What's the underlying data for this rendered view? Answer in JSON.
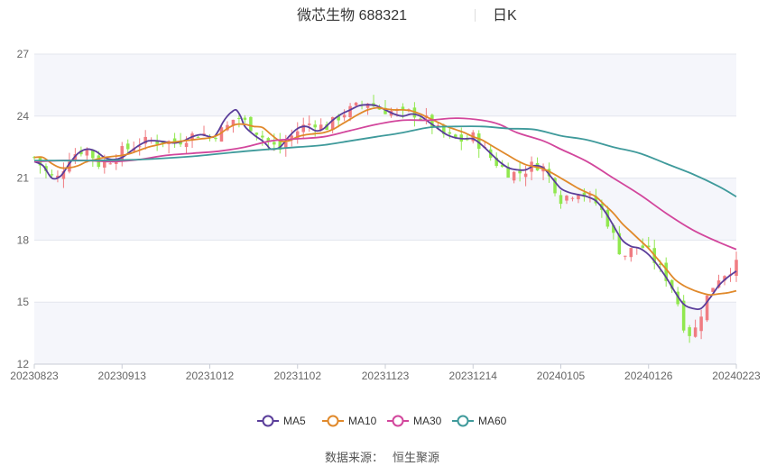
{
  "title": {
    "stock": "微芯生物 688321",
    "period": "日K"
  },
  "source": {
    "label": "数据来源：",
    "name": "恒生聚源"
  },
  "chart_data": {
    "type": "candlestick",
    "ylim": [
      12,
      27
    ],
    "yticks": [
      12,
      15,
      18,
      21,
      24,
      27
    ],
    "x_tick_labels": [
      "20230823",
      "20230913",
      "20231012",
      "20231102",
      "20231123",
      "20231214",
      "20240105",
      "20240126",
      "20240223"
    ],
    "band_fills": [
      "#f5f6fb",
      "#ffffff"
    ],
    "up_color": "#f07c82",
    "down_color": "#91e84f",
    "bars_count": 121,
    "close_path": [
      [
        0,
        22.0
      ],
      [
        3,
        21.2
      ],
      [
        5,
        20.9
      ],
      [
        8,
        22.0
      ],
      [
        10,
        22.3
      ],
      [
        12,
        22.4
      ],
      [
        15,
        21.6
      ],
      [
        18,
        22.0
      ],
      [
        20,
        22.3
      ],
      [
        23,
        22.6
      ],
      [
        26,
        22.8
      ],
      [
        29,
        22.8
      ],
      [
        32,
        22.7
      ],
      [
        35,
        23.0
      ],
      [
        38,
        23.2
      ],
      [
        40,
        23.0
      ],
      [
        42,
        23.2
      ],
      [
        44,
        23.5
      ],
      [
        46,
        24.0
      ],
      [
        48,
        23.7
      ],
      [
        50,
        23.4
      ],
      [
        52,
        23.0
      ],
      [
        54,
        22.6
      ],
      [
        56,
        22.4
      ],
      [
        58,
        22.9
      ],
      [
        60,
        23.3
      ],
      [
        62,
        23.6
      ],
      [
        64,
        23.7
      ],
      [
        66,
        23.4
      ],
      [
        68,
        23.7
      ],
      [
        70,
        24.1
      ],
      [
        72,
        24.3
      ],
      [
        74,
        24.5
      ],
      [
        76,
        24.7
      ],
      [
        78,
        24.4
      ],
      [
        80,
        24.3
      ],
      [
        82,
        24.2
      ],
      [
        84,
        24.1
      ],
      [
        86,
        24.2
      ],
      [
        88,
        24.0
      ],
      [
        90,
        23.7
      ],
      [
        92,
        23.3
      ],
      [
        94,
        23.0
      ],
      [
        96,
        22.9
      ],
      [
        98,
        22.8
      ],
      [
        100,
        23.0
      ],
      [
        102,
        22.5
      ],
      [
        104,
        22.0
      ],
      [
        106,
        21.6
      ],
      [
        108,
        21.3
      ],
      [
        110,
        21.2
      ],
      [
        112,
        21.4
      ],
      [
        114,
        21.7
      ],
      [
        116,
        21.5
      ],
      [
        118,
        20.8
      ],
      [
        120,
        20.0
      ],
      [
        122,
        20.2
      ],
      [
        124,
        20.4
      ],
      [
        126,
        20.1
      ],
      [
        128,
        19.8
      ],
      [
        130,
        19.2
      ],
      [
        132,
        18.2
      ],
      [
        134,
        17.2
      ],
      [
        136,
        17.5
      ],
      [
        138,
        17.8
      ],
      [
        140,
        17.4
      ],
      [
        142,
        16.8
      ],
      [
        144,
        16.2
      ],
      [
        146,
        15.5
      ],
      [
        148,
        13.9
      ],
      [
        150,
        13.3
      ],
      [
        152,
        14.5
      ],
      [
        154,
        15.6
      ],
      [
        156,
        16.2
      ],
      [
        158,
        16.5
      ],
      [
        160,
        16.8
      ]
    ],
    "series": [
      {
        "name": "MA5",
        "color": "#5a3d9a",
        "values": [
          [
            0,
            21.8
          ],
          [
            2,
            21.6
          ],
          [
            4,
            21.0
          ],
          [
            6,
            21.1
          ],
          [
            8,
            21.7
          ],
          [
            10,
            22.2
          ],
          [
            12,
            22.4
          ],
          [
            14,
            22.3
          ],
          [
            16,
            22.0
          ],
          [
            18,
            21.9
          ],
          [
            20,
            22.0
          ],
          [
            22,
            22.3
          ],
          [
            24,
            22.6
          ],
          [
            26,
            22.8
          ],
          [
            28,
            22.8
          ],
          [
            30,
            22.75
          ],
          [
            32,
            22.7
          ],
          [
            34,
            22.8
          ],
          [
            36,
            23.0
          ],
          [
            38,
            23.1
          ],
          [
            40,
            23.0
          ],
          [
            41,
            23.0
          ],
          [
            42,
            23.3
          ],
          [
            43,
            23.7
          ],
          [
            44,
            24.0
          ],
          [
            45,
            24.2
          ],
          [
            46,
            24.3
          ],
          [
            47,
            24.0
          ],
          [
            48,
            23.5
          ],
          [
            50,
            23.1
          ],
          [
            52,
            22.8
          ],
          [
            53,
            22.6
          ],
          [
            54,
            22.4
          ],
          [
            56,
            22.5
          ],
          [
            58,
            23.0
          ],
          [
            60,
            23.4
          ],
          [
            62,
            23.5
          ],
          [
            64,
            23.3
          ],
          [
            65,
            23.3
          ],
          [
            66,
            23.4
          ],
          [
            68,
            23.8
          ],
          [
            70,
            24.1
          ],
          [
            72,
            24.3
          ],
          [
            74,
            24.5
          ],
          [
            76,
            24.55
          ],
          [
            78,
            24.5
          ],
          [
            80,
            24.3
          ],
          [
            82,
            24.1
          ],
          [
            84,
            24.0
          ],
          [
            86,
            24.1
          ],
          [
            88,
            24.0
          ],
          [
            90,
            23.7
          ],
          [
            92,
            23.4
          ],
          [
            94,
            23.1
          ],
          [
            96,
            22.95
          ],
          [
            98,
            22.9
          ],
          [
            100,
            22.9
          ],
          [
            102,
            22.6
          ],
          [
            104,
            22.2
          ],
          [
            106,
            21.8
          ],
          [
            108,
            21.5
          ],
          [
            110,
            21.4
          ],
          [
            112,
            21.4
          ],
          [
            114,
            21.6
          ],
          [
            116,
            21.5
          ],
          [
            118,
            21.0
          ],
          [
            120,
            20.5
          ],
          [
            122,
            20.3
          ],
          [
            124,
            20.2
          ],
          [
            126,
            20.1
          ],
          [
            128,
            19.9
          ],
          [
            130,
            19.4
          ],
          [
            132,
            18.7
          ],
          [
            134,
            18.0
          ],
          [
            136,
            17.7
          ],
          [
            138,
            17.6
          ],
          [
            140,
            17.3
          ],
          [
            142,
            16.8
          ],
          [
            144,
            16.2
          ],
          [
            146,
            15.5
          ],
          [
            148,
            14.9
          ],
          [
            150,
            14.7
          ],
          [
            152,
            14.7
          ],
          [
            154,
            15.2
          ],
          [
            156,
            15.8
          ],
          [
            158,
            16.2
          ],
          [
            160,
            16.5
          ]
        ]
      },
      {
        "name": "MA10",
        "color": "#e0892b",
        "values": [
          [
            0,
            22.0
          ],
          [
            2,
            22.0
          ],
          [
            4,
            21.7
          ],
          [
            6,
            21.5
          ],
          [
            8,
            21.5
          ],
          [
            10,
            21.6
          ],
          [
            12,
            21.8
          ],
          [
            14,
            21.9
          ],
          [
            16,
            22.0
          ],
          [
            18,
            22.05
          ],
          [
            20,
            22.1
          ],
          [
            22,
            22.2
          ],
          [
            24,
            22.35
          ],
          [
            26,
            22.5
          ],
          [
            28,
            22.6
          ],
          [
            30,
            22.7
          ],
          [
            32,
            22.75
          ],
          [
            34,
            22.8
          ],
          [
            36,
            22.85
          ],
          [
            38,
            22.9
          ],
          [
            40,
            22.95
          ],
          [
            42,
            23.1
          ],
          [
            44,
            23.4
          ],
          [
            46,
            23.6
          ],
          [
            48,
            23.6
          ],
          [
            50,
            23.5
          ],
          [
            52,
            23.45
          ],
          [
            54,
            23.1
          ],
          [
            56,
            22.8
          ],
          [
            58,
            22.8
          ],
          [
            60,
            23.0
          ],
          [
            62,
            23.1
          ],
          [
            64,
            23.15
          ],
          [
            66,
            23.2
          ],
          [
            68,
            23.35
          ],
          [
            70,
            23.6
          ],
          [
            72,
            23.85
          ],
          [
            74,
            24.1
          ],
          [
            76,
            24.3
          ],
          [
            78,
            24.4
          ],
          [
            80,
            24.35
          ],
          [
            82,
            24.3
          ],
          [
            84,
            24.3
          ],
          [
            86,
            24.25
          ],
          [
            88,
            24.1
          ],
          [
            90,
            23.9
          ],
          [
            92,
            23.7
          ],
          [
            94,
            23.5
          ],
          [
            96,
            23.35
          ],
          [
            98,
            23.2
          ],
          [
            100,
            23.0
          ],
          [
            102,
            22.85
          ],
          [
            104,
            22.6
          ],
          [
            106,
            22.35
          ],
          [
            108,
            22.1
          ],
          [
            110,
            21.85
          ],
          [
            112,
            21.65
          ],
          [
            114,
            21.55
          ],
          [
            116,
            21.45
          ],
          [
            118,
            21.25
          ],
          [
            120,
            21.0
          ],
          [
            122,
            20.75
          ],
          [
            124,
            20.5
          ],
          [
            126,
            20.3
          ],
          [
            128,
            20.1
          ],
          [
            130,
            19.7
          ],
          [
            132,
            19.3
          ],
          [
            134,
            18.8
          ],
          [
            136,
            18.4
          ],
          [
            138,
            18.0
          ],
          [
            140,
            17.6
          ],
          [
            142,
            17.1
          ],
          [
            144,
            16.6
          ],
          [
            146,
            16.1
          ],
          [
            148,
            15.8
          ],
          [
            150,
            15.6
          ],
          [
            152,
            15.45
          ],
          [
            154,
            15.35
          ],
          [
            156,
            15.4
          ],
          [
            158,
            15.45
          ],
          [
            160,
            15.55
          ]
        ]
      },
      {
        "name": "MA30",
        "color": "#d2469c",
        "values": [
          [
            0,
            21.8
          ],
          [
            6,
            21.85
          ],
          [
            12,
            21.85
          ],
          [
            18,
            21.8
          ],
          [
            24,
            21.9
          ],
          [
            30,
            22.1
          ],
          [
            36,
            22.2
          ],
          [
            42,
            22.3
          ],
          [
            48,
            22.5
          ],
          [
            54,
            22.8
          ],
          [
            60,
            22.9
          ],
          [
            66,
            23.0
          ],
          [
            72,
            23.3
          ],
          [
            78,
            23.6
          ],
          [
            84,
            23.8
          ],
          [
            90,
            23.8
          ],
          [
            96,
            23.9
          ],
          [
            102,
            23.8
          ],
          [
            106,
            23.6
          ],
          [
            110,
            23.2
          ],
          [
            116,
            22.8
          ],
          [
            120,
            22.4
          ],
          [
            126,
            21.8
          ],
          [
            132,
            21.0
          ],
          [
            138,
            20.2
          ],
          [
            144,
            19.3
          ],
          [
            150,
            18.5
          ],
          [
            156,
            17.9
          ],
          [
            160,
            17.55
          ]
        ]
      },
      {
        "name": "MA60",
        "color": "#3f9a9b",
        "values": [
          [
            0,
            21.85
          ],
          [
            12,
            21.85
          ],
          [
            24,
            21.9
          ],
          [
            36,
            22.05
          ],
          [
            48,
            22.3
          ],
          [
            60,
            22.5
          ],
          [
            66,
            22.6
          ],
          [
            72,
            22.8
          ],
          [
            78,
            23.0
          ],
          [
            84,
            23.2
          ],
          [
            90,
            23.45
          ],
          [
            96,
            23.5
          ],
          [
            102,
            23.5
          ],
          [
            108,
            23.4
          ],
          [
            114,
            23.35
          ],
          [
            120,
            23.05
          ],
          [
            126,
            22.85
          ],
          [
            132,
            22.5
          ],
          [
            138,
            22.2
          ],
          [
            144,
            21.7
          ],
          [
            150,
            21.2
          ],
          [
            156,
            20.6
          ],
          [
            160,
            20.1
          ]
        ]
      }
    ],
    "legend": {
      "placement": "bottom-center",
      "entries": [
        "MA5",
        "MA10",
        "MA30",
        "MA60"
      ]
    }
  }
}
